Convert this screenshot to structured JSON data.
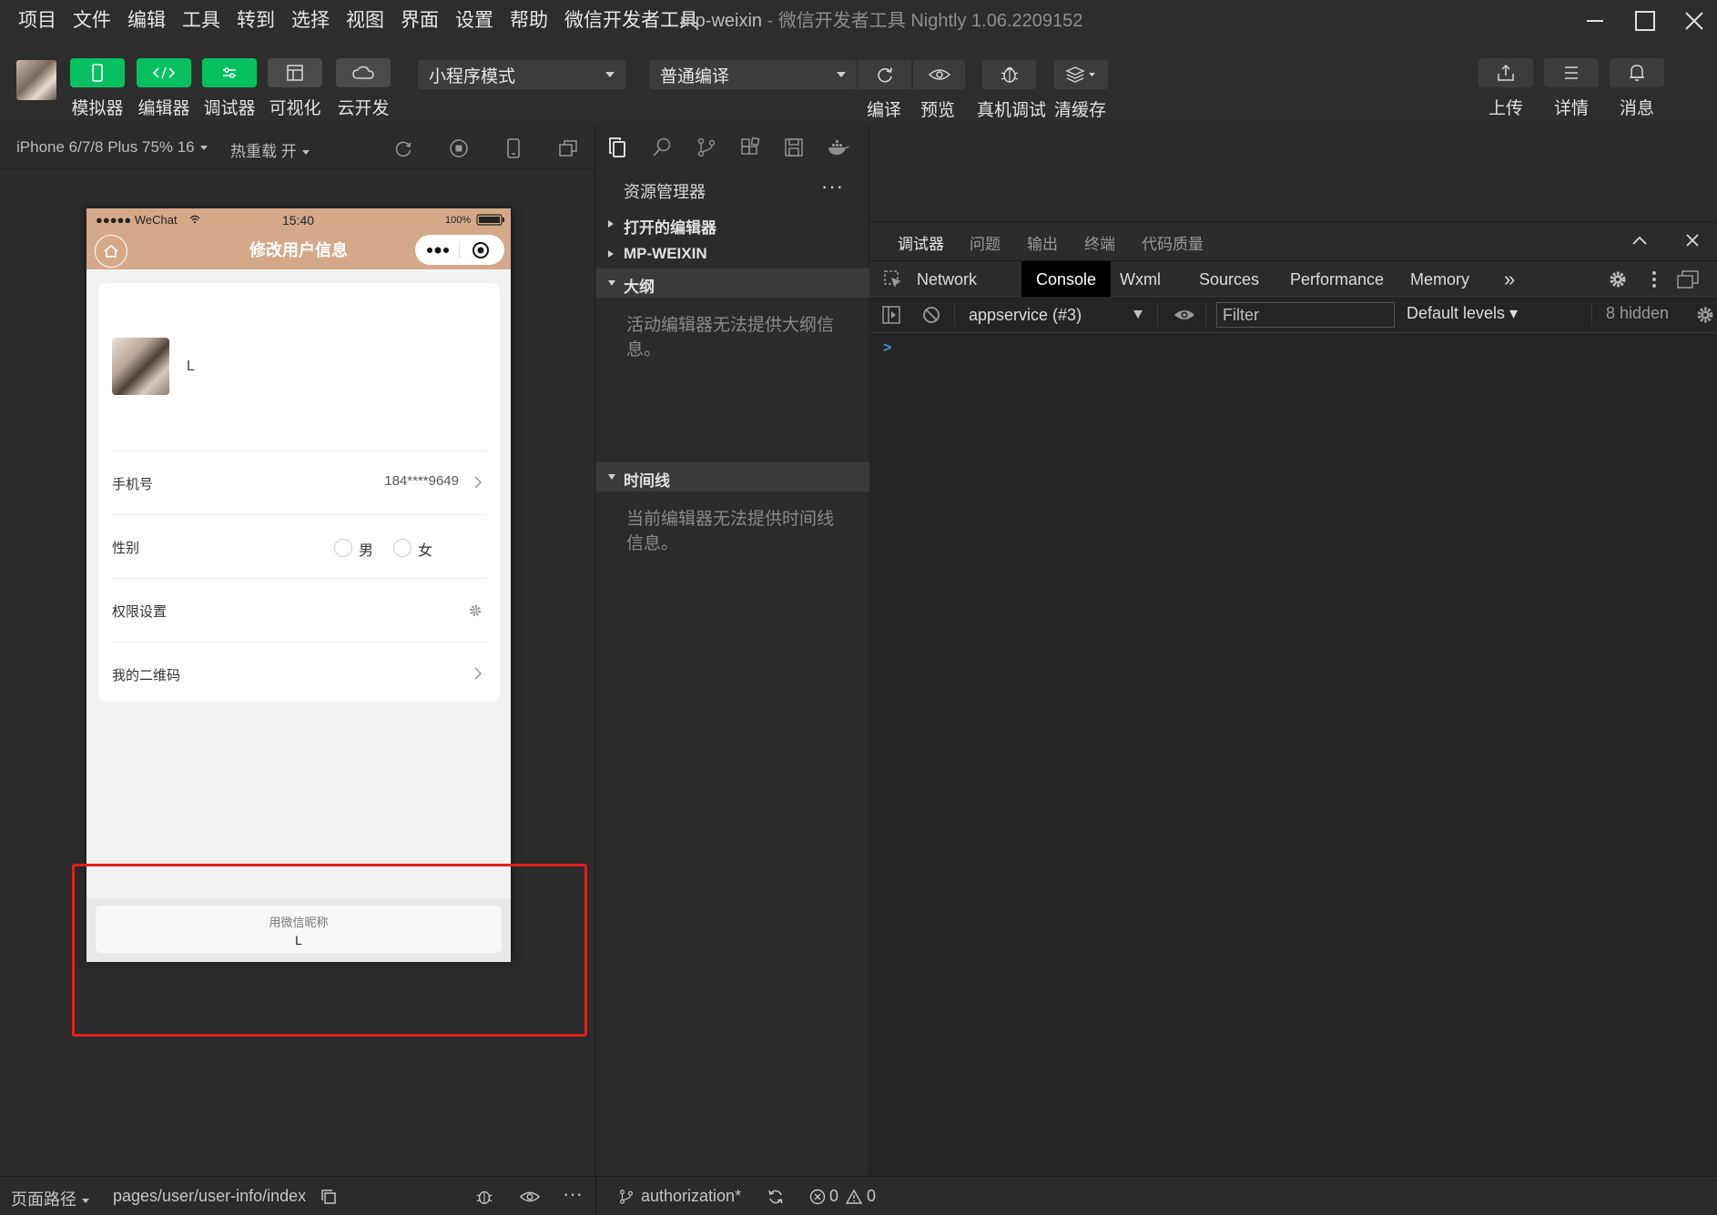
{
  "menu": {
    "items": [
      "项目",
      "文件",
      "编辑",
      "工具",
      "转到",
      "选择",
      "视图",
      "界面",
      "设置",
      "帮助",
      "微信开发者工具"
    ],
    "window_title_project": "mp-weixin",
    "window_title_sep": " - ",
    "window_title_product": "微信开发者工具 Nightly 1.06.2209152"
  },
  "toolbar": {
    "simulator": "模拟器",
    "editor": "编辑器",
    "debugger": "调试器",
    "visual": "可视化",
    "cloud": "云开发",
    "mode_select": "小程序模式",
    "compile_select": "普通编译",
    "compile": "编译",
    "preview": "预览",
    "remote_debug": "真机调试",
    "clear_cache": "清缓存",
    "upload": "上传",
    "details": "详情",
    "messages": "消息"
  },
  "simulator": {
    "device": "iPhone 6/7/8 Plus 75% 16",
    "hot_reload": "热重载 开",
    "status_bar": {
      "carrier": "●●●●● WeChat",
      "time": "15:40",
      "battery": "100%"
    },
    "nav_title": "修改用户信息",
    "profile_name": "L",
    "rows": {
      "phone_label": "手机号",
      "phone_value": "184****9649",
      "gender_label": "性别",
      "gender_male": "男",
      "gender_female": "女",
      "permission_label": "权限设置",
      "qrcode_label": "我的二维码"
    },
    "sheet": {
      "title": "用微信昵称",
      "value": "L"
    }
  },
  "explorer": {
    "title": "资源管理器",
    "more": "···",
    "sections": {
      "open_editors": "打开的编辑器",
      "project": "MP-WEIXIN",
      "outline": "大纲",
      "outline_note": "活动编辑器无法提供大纲信息。",
      "timeline": "时间线",
      "timeline_note": "当前编辑器无法提供时间线信息。"
    }
  },
  "debugger": {
    "tabs": [
      "调试器",
      "问题",
      "输出",
      "终端",
      "代码质量"
    ],
    "devtools_tabs": [
      "Network",
      "Console",
      "Wxml",
      "Sources",
      "Performance",
      "Memory"
    ],
    "more_tabs": "»",
    "context": "appservice (#3)",
    "filter_placeholder": "Filter",
    "levels": "Default levels ▾",
    "hidden": "8 hidden",
    "prompt": ">"
  },
  "statusbar": {
    "page_path_label": "页面路径",
    "page_path": "pages/user/user-info/index",
    "branch": "authorization*",
    "errors": "0",
    "warnings": "0",
    "more": "···"
  },
  "colors": {
    "accent_green": "#07c160",
    "nav_bar": "#d4a98a",
    "highlight_red": "#e02020"
  }
}
